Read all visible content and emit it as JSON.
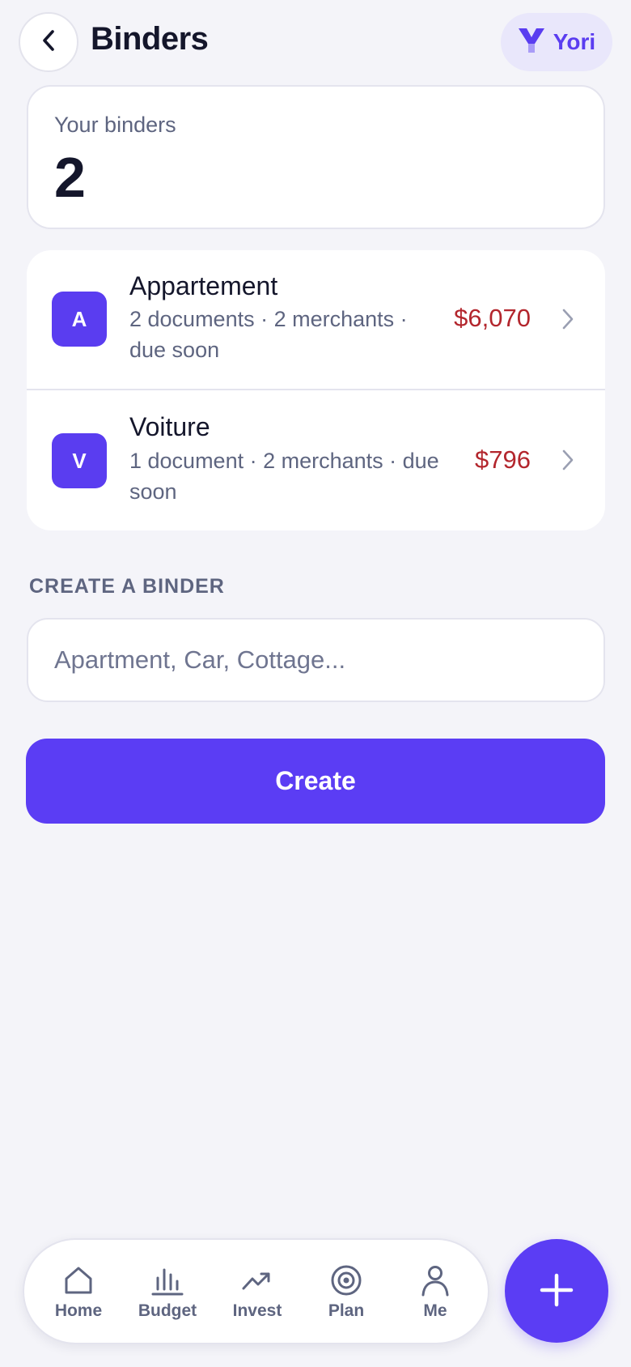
{
  "header": {
    "title": "Binders",
    "brand_name": "Yori"
  },
  "summary": {
    "label": "Your binders",
    "count": "2"
  },
  "binders": [
    {
      "initial": "A",
      "name": "Appartement",
      "meta": "2 documents · 2 merchants · due soon",
      "amount": "$6,070"
    },
    {
      "initial": "V",
      "name": "Voiture",
      "meta": "1 document · 2 merchants · due soon",
      "amount": "$796"
    }
  ],
  "create": {
    "section_label": "CREATE A BINDER",
    "input_placeholder": "Apartment, Car, Cottage...",
    "input_value": "",
    "button_label": "Create"
  },
  "nav": {
    "items": [
      {
        "label": "Home",
        "icon": "home-icon"
      },
      {
        "label": "Budget",
        "icon": "bar-chart-icon"
      },
      {
        "label": "Invest",
        "icon": "trend-up-icon"
      },
      {
        "label": "Plan",
        "icon": "target-icon"
      },
      {
        "label": "Me",
        "icon": "user-icon"
      }
    ],
    "fab_icon": "plus-icon"
  },
  "colors": {
    "accent": "#5b3df4",
    "amount_due": "#b3262d",
    "background": "#f4f4f9",
    "muted_text": "#5e6580"
  }
}
